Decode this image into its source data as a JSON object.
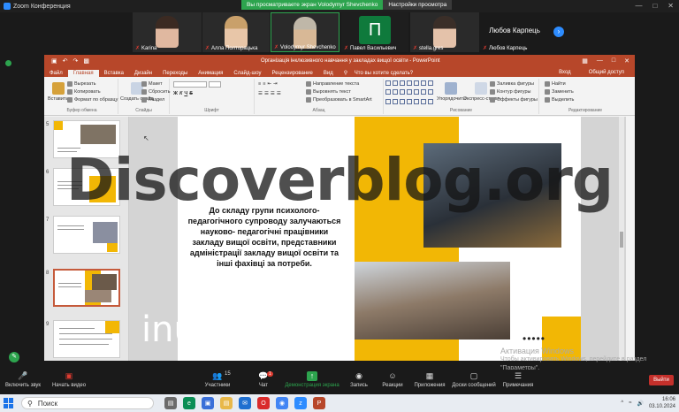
{
  "zoom": {
    "app_title": "Zoom Конференция",
    "share_banner": "Вы просматриваете экран Volodymyr Shevchenko",
    "view_options": "Настройки просмотра",
    "participants_tiles": [
      {
        "name": "Karina",
        "muted": true
      },
      {
        "name": "Алла Полторацька",
        "muted": true
      },
      {
        "name": "Volodymyr Shevchenko",
        "muted": true
      },
      {
        "name": "Павел Васильевич",
        "muted": true,
        "avatar_letter": "П"
      },
      {
        "name": "stella.gres",
        "muted": true
      },
      {
        "name": "Любов Карпець",
        "muted": true,
        "title": "Любов Карпець"
      }
    ],
    "toolbar": {
      "audio": "Включить звук",
      "video": "Начать видео",
      "participants": "Участники",
      "participants_count": "15",
      "chat": "Чат",
      "chat_badge": "1",
      "share": "Демонстрация экрана",
      "record": "Запись",
      "reactions": "Реакции",
      "apps": "Приложения",
      "whiteboards": "Доски сообщений",
      "notes": "Примечания",
      "exit": "Выйти"
    }
  },
  "powerpoint": {
    "doc_title": "Організація інклюзивного навчання у закладах вищої освіти  -  PowerPoint",
    "tabs": [
      "Файл",
      "Главная",
      "Вставка",
      "Дизайн",
      "Переходы",
      "Анимация",
      "Слайд-шоу",
      "Рецензирование",
      "Вид"
    ],
    "active_tab": "Главная",
    "tell_me": "Что вы хотите сделать?",
    "right_tabs": [
      "Вход",
      "Общий доступ"
    ],
    "ribbon": {
      "clipboard": {
        "label": "Буфер обмена",
        "paste": "Вставить",
        "cut": "Вырезать",
        "copy": "Копировать",
        "format_painter": "Формат по образцу"
      },
      "slides": {
        "label": "Слайды",
        "new_slide": "Создать слайд",
        "layout": "Макет",
        "reset": "Сбросить",
        "section": "Раздел"
      },
      "font": {
        "label": "Шрифт"
      },
      "paragraph": {
        "label": "Абзац",
        "text_direction": "Направление текста",
        "align_text": "Выровнять текст",
        "smartart": "Преобразовать в SmartArt"
      },
      "drawing": {
        "label": "Рисование",
        "arrange": "Упорядочить",
        "quick_styles": "Экспресс-стили",
        "fill": "Заливка фигуры",
        "outline": "Контур фигуры",
        "effects": "Эффекты фигуры"
      },
      "editing": {
        "label": "Редактирование",
        "find": "Найти",
        "replace": "Заменить",
        "select": "Выделить"
      }
    },
    "thumbnails": [
      {
        "num": "5"
      },
      {
        "num": "6"
      },
      {
        "num": "7"
      },
      {
        "num": "8",
        "selected": true
      },
      {
        "num": "9"
      }
    ],
    "slide": {
      "body": "До складу групи психолого-педагогічного  супроводу залучаються науково- педагогічні працівники закладу вищої освіти, представники адміністрації  закладу вищої освіти та інші фахівці за потреби.",
      "dots": "•••••"
    }
  },
  "overlay": {
    "watermark": "Discoverblog.org",
    "inurl": "inurl tmp",
    "activation_title": "Активация Windows",
    "activation_text": "Чтобы активировать Windows, перейдите в раздел \"Параметры\"."
  },
  "taskbar": {
    "search_placeholder": "Поиск",
    "time": "16:06",
    "date": "03.10.2024"
  },
  "colors": {
    "ppt_accent": "#b7472a",
    "slide_yellow": "#f2b705",
    "zoom_green": "#2da44e",
    "zoom_exit": "#c4302b"
  }
}
